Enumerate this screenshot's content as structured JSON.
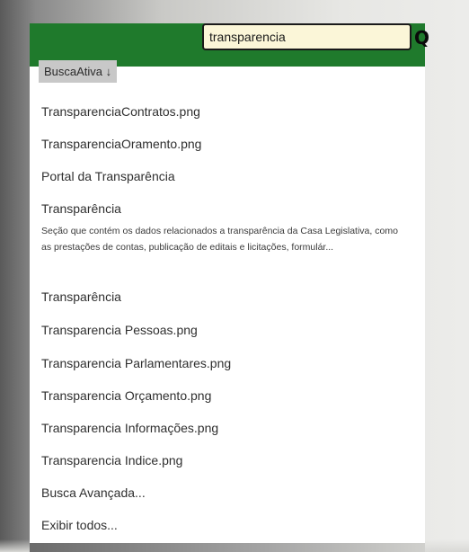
{
  "search": {
    "value": "transparencia",
    "go_icon": "magnifier-icon"
  },
  "sort": {
    "label": "BuscaAtiva ↓"
  },
  "results": [
    {
      "title": "TransparenciaContratos.png"
    },
    {
      "title": "TransparenciaOramento.png"
    },
    {
      "title": "Portal da Transparência"
    },
    {
      "title": "Transparência",
      "description": "Seção que contém os dados relacionados a transparência da Casa Legislativa, como as prestações de contas, publicação de editais e licitações, formulár..."
    },
    {
      "title": "Transparência"
    },
    {
      "title": "Transparencia Pessoas.png"
    },
    {
      "title": "Transparencia Parlamentares.png"
    },
    {
      "title": "Transparencia Orçamento.png"
    },
    {
      "title": "Transparencia Informações.png"
    },
    {
      "title": "Transparencia Indice.png"
    }
  ],
  "footer_links": {
    "advanced": "Busca Avançada...",
    "show_all": "Exibir todos..."
  },
  "colors": {
    "header_green": "#1f7a2c",
    "search_bg": "#fbf6d8"
  }
}
